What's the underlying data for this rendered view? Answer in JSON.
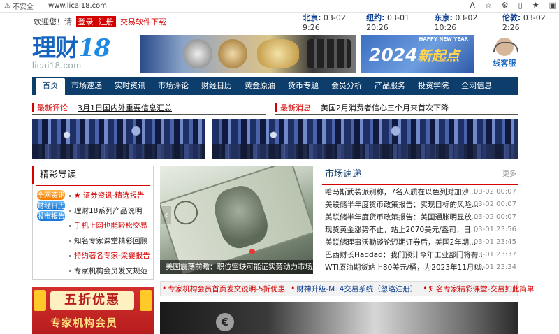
{
  "browser": {
    "security_label": "不安全",
    "url": "www.licai18.com",
    "toolbar_icons": [
      "read-aloud-icon",
      "favorite-icon",
      "extensions-icon",
      "split-screen-icon",
      "favorites-bar-icon",
      "collections-icon"
    ]
  },
  "topbar": {
    "welcome": "欢迎您！请",
    "login": "登录",
    "register": "注册",
    "download": "交易软件下载",
    "clocks": [
      {
        "city": "北京:",
        "time": "03-02 9:26"
      },
      {
        "city": "纽约:",
        "time": "03-01 20:26"
      },
      {
        "city": "东京:",
        "time": "03-02 10:26"
      },
      {
        "city": "伦敦:",
        "time": "03-02 2:26"
      }
    ]
  },
  "header": {
    "logo_main": "理财",
    "logo_num": "18",
    "logo_url": "licai18.com",
    "banner_new_year": "HAPPY NEW YEAR",
    "banner_year": "2024",
    "banner_slogan": "新起点",
    "service_label": "线客服"
  },
  "nav": {
    "items": [
      "首页",
      "市场速递",
      "实时资讯",
      "市场评论",
      "财经日历",
      "黄金原油",
      "货币专题",
      "会员分析",
      "产品服务",
      "投资学院",
      "全网信息"
    ]
  },
  "ticker_left": {
    "tag": "最新评论",
    "text": "3月1日国内外重要信息汇总"
  },
  "ticker_right": {
    "tag": "最新消息",
    "text": "美国2月消费者信心三个月来首次下降"
  },
  "guide": {
    "title": "精彩导读",
    "icons": [
      {
        "label": "全网资讯",
        "color": "#f57c00"
      },
      {
        "label": "财经日历",
        "color": "#1976d2"
      },
      {
        "label": "股市报告",
        "color": "#1976d2"
      }
    ],
    "items": [
      {
        "text": "★ 证券资讯-精选报告",
        "red": true
      },
      {
        "text": "理财18系列产品说明",
        "red": false
      },
      {
        "text": "手机上网也能轻松交易",
        "red": true
      },
      {
        "text": "知名专家课堂精彩回顾",
        "red": false
      },
      {
        "text": "特约著名专家-梁孌报告",
        "red": true
      },
      {
        "text": "专家机构会员发文规范",
        "red": false
      }
    ]
  },
  "carousel": {
    "serial": "22519D",
    "caption": "美国震荡前瞻：职位空缺可能证实劳动力市场逐"
  },
  "market": {
    "title": "市场速递",
    "more": "更多",
    "rows": [
      {
        "title": "哈马斯武装派别称，7名人质在以色列对加沙...",
        "date": "03-02 00:07"
      },
      {
        "title": "美联储半年度货币政策报告：实现目标的风险...",
        "date": "03-02 00:07"
      },
      {
        "title": "美联储半年度货币政策报告：美国通胀明显放...",
        "date": "03-02 00:07"
      },
      {
        "title": "现货黄金涨势不止，站上2070美元/盎司，日...",
        "date": "03-01 23:56"
      },
      {
        "title": "美联储理事沃勒谈论短期证券后，美国2年期...",
        "date": "03-01 23:45"
      },
      {
        "title": "巴西财长Haddad：我们预计今年工业部门将有...",
        "date": "03-01 23:37"
      },
      {
        "title": "WTI原油期货站上80美元/桶，为2023年11月以...",
        "date": "03-01 23:34"
      }
    ]
  },
  "links": {
    "items": [
      {
        "text": "专家机构会员首页发文说明-5折优惠",
        "blue": false
      },
      {
        "text": "财神升级-MT4交易系统（忽略注册）",
        "blue": true
      },
      {
        "text": "知名专家精彩课堂-交易如此简单",
        "blue": false
      }
    ]
  },
  "promo": {
    "line1": "五折优惠",
    "line2": "专家机构会员"
  }
}
